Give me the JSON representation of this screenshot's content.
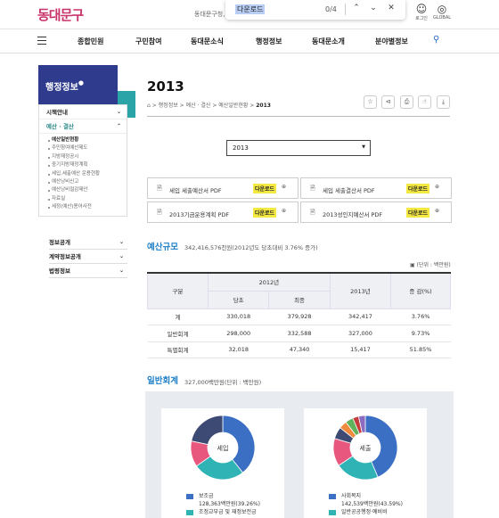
{
  "header": {
    "logo": "동대문구",
    "top_note": "동대문구청,",
    "find": {
      "query": "다운로드",
      "count": "0/4"
    },
    "login_label": "로그인",
    "global_label": "GLOBAL"
  },
  "nav": {
    "items": [
      "종합민원",
      "구민참여",
      "동대문소식",
      "행정정보",
      "동대문소개",
      "분야별정보"
    ]
  },
  "sidebar": {
    "title": "행정정보",
    "sections": [
      {
        "label": "시책안내"
      },
      {
        "label": "예산 · 결산"
      }
    ],
    "sub_items": [
      "예산일반현황",
      "주민참여예산제도",
      "지방재정공시",
      "중기지방재정계획",
      "세입,세출예산 운용현황",
      "예산낭비신고",
      "예산낭비절감제안",
      "자료실",
      "세정(예산)용어사전"
    ],
    "lower": [
      "정보공개",
      "계약정보공개",
      "법령정보"
    ]
  },
  "main": {
    "title": "2013",
    "breadcrumb": {
      "a": "행정정보",
      "b": "예산 · 결산",
      "c": "예산일반현황",
      "d": "2013"
    },
    "year_select": "2013",
    "downloads": [
      {
        "name": "세입 세출예산서 PDF",
        "btn": "다운로드"
      },
      {
        "name": "세입 세출결산서 PDF",
        "btn": "다운로드"
      },
      {
        "name": "2013기금운용계획 PDF",
        "btn": "다운로드"
      },
      {
        "name": "2013성인지예산서 PDF",
        "btn": "다운로드"
      }
    ],
    "budget": {
      "title": "예산규모",
      "summary": "342,416,576천원(2012년도 당초대비 3.76% 증가)",
      "unit": "(단위 : 백만원)",
      "headers": {
        "gubun": "구분",
        "y2012": "2012년",
        "initial": "당초",
        "final": "최종",
        "y2013": "2013년",
        "rate": "증 감(%)"
      },
      "rows": [
        {
          "name": "계",
          "initial": "330,018",
          "final": "379,928",
          "y2013": "342,417",
          "rate": "3.76%"
        },
        {
          "name": "일반회계",
          "initial": "298,000",
          "final": "332,588",
          "y2013": "327,000",
          "rate": "9.73%"
        },
        {
          "name": "특별회계",
          "initial": "32,018",
          "final": "47,340",
          "y2013": "15,417",
          "rate": "51.85%"
        }
      ]
    },
    "general": {
      "title": "일반회계",
      "summary": "327,000백만원(단위 : 백만원)",
      "charts": [
        {
          "center": "세입",
          "legend": [
            {
              "name": "보조금",
              "value": "128,363백만원(39.26%)",
              "color": "#3a6fc4"
            },
            {
              "name": "조정교부금 및 재정보전금",
              "value": "",
              "color": "#2fb3b5"
            }
          ],
          "slices": [
            {
              "color": "#3a6fc4",
              "pct": 39.26
            },
            {
              "color": "#2fb3b5",
              "pct": 26.0
            },
            {
              "color": "#e8587e",
              "pct": 13.0
            },
            {
              "color": "#3d4a73",
              "pct": 21.74
            }
          ]
        },
        {
          "center": "세출",
          "legend": [
            {
              "name": "사회복지",
              "value": "142,539백만원(43.59%)",
              "color": "#3a6fc4"
            },
            {
              "name": "일반공공행정·예비비",
              "value": "",
              "color": "#2fb3b5"
            }
          ],
          "slices": [
            {
              "color": "#3a6fc4",
              "pct": 43.59
            },
            {
              "color": "#2fb3b5",
              "pct": 22.0
            },
            {
              "color": "#e8587e",
              "pct": 14.0
            },
            {
              "color": "#3d4a73",
              "pct": 6.0
            },
            {
              "color": "#f08a3c",
              "pct": 4.0
            },
            {
              "color": "#5fb35a",
              "pct": 4.0
            },
            {
              "color": "#c43d3d",
              "pct": 3.0
            },
            {
              "color": "#8b6cc1",
              "pct": 3.41
            }
          ]
        }
      ]
    }
  }
}
